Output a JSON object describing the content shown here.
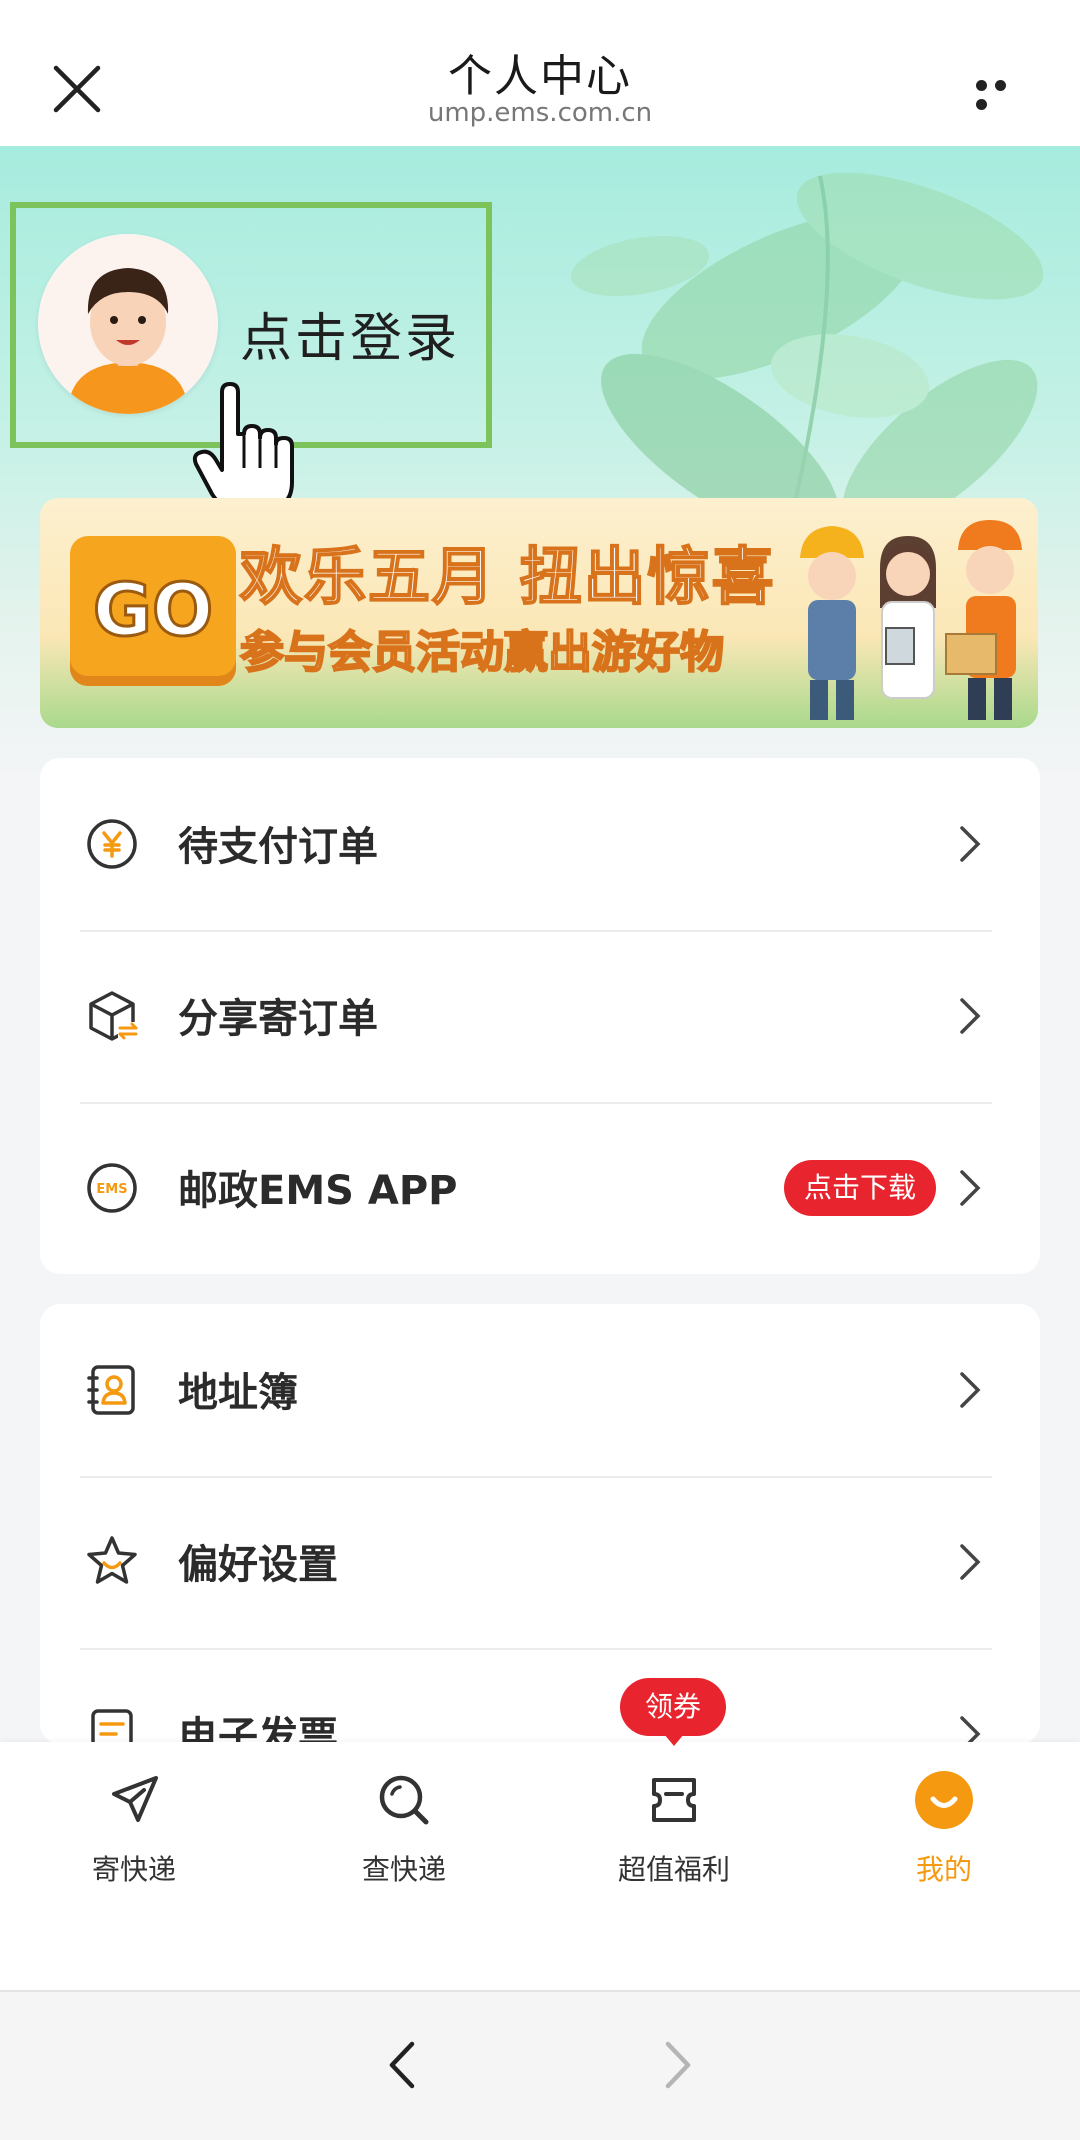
{
  "header": {
    "title": "个人中心",
    "url": "ump.ems.com.cn",
    "close_icon": "close-icon",
    "more_icon": "more-icon"
  },
  "profile": {
    "login_text": "点击登录"
  },
  "banner": {
    "badge": "GO",
    "title": "欢乐五月  扭出惊喜",
    "subtitle": "参与会员活动赢出游好物"
  },
  "menu_group_1": [
    {
      "label": "待支付订单",
      "icon": "yuan-coin-icon"
    },
    {
      "label": "分享寄订单",
      "icon": "package-share-icon"
    },
    {
      "label": "邮政EMS APP",
      "icon": "ems-logo-icon",
      "badge": "点击下载"
    }
  ],
  "menu_group_2": [
    {
      "label": "地址簿",
      "icon": "address-book-icon"
    },
    {
      "label": "偏好设置",
      "icon": "star-smile-icon"
    },
    {
      "label": "电子发票",
      "icon": "invoice-icon"
    }
  ],
  "tabbar": {
    "coupon_badge": "领券",
    "tabs": [
      {
        "label": "寄快递",
        "icon": "paper-plane-icon"
      },
      {
        "label": "查快递",
        "icon": "search-icon"
      },
      {
        "label": "超值福利",
        "icon": "gift-ticket-icon"
      },
      {
        "label": "我的",
        "icon": "smile-face-icon",
        "active": true
      }
    ]
  },
  "colors": {
    "accent": "#f59a10",
    "badge_red": "#e8242e",
    "highlight_green": "#7cc35c"
  }
}
